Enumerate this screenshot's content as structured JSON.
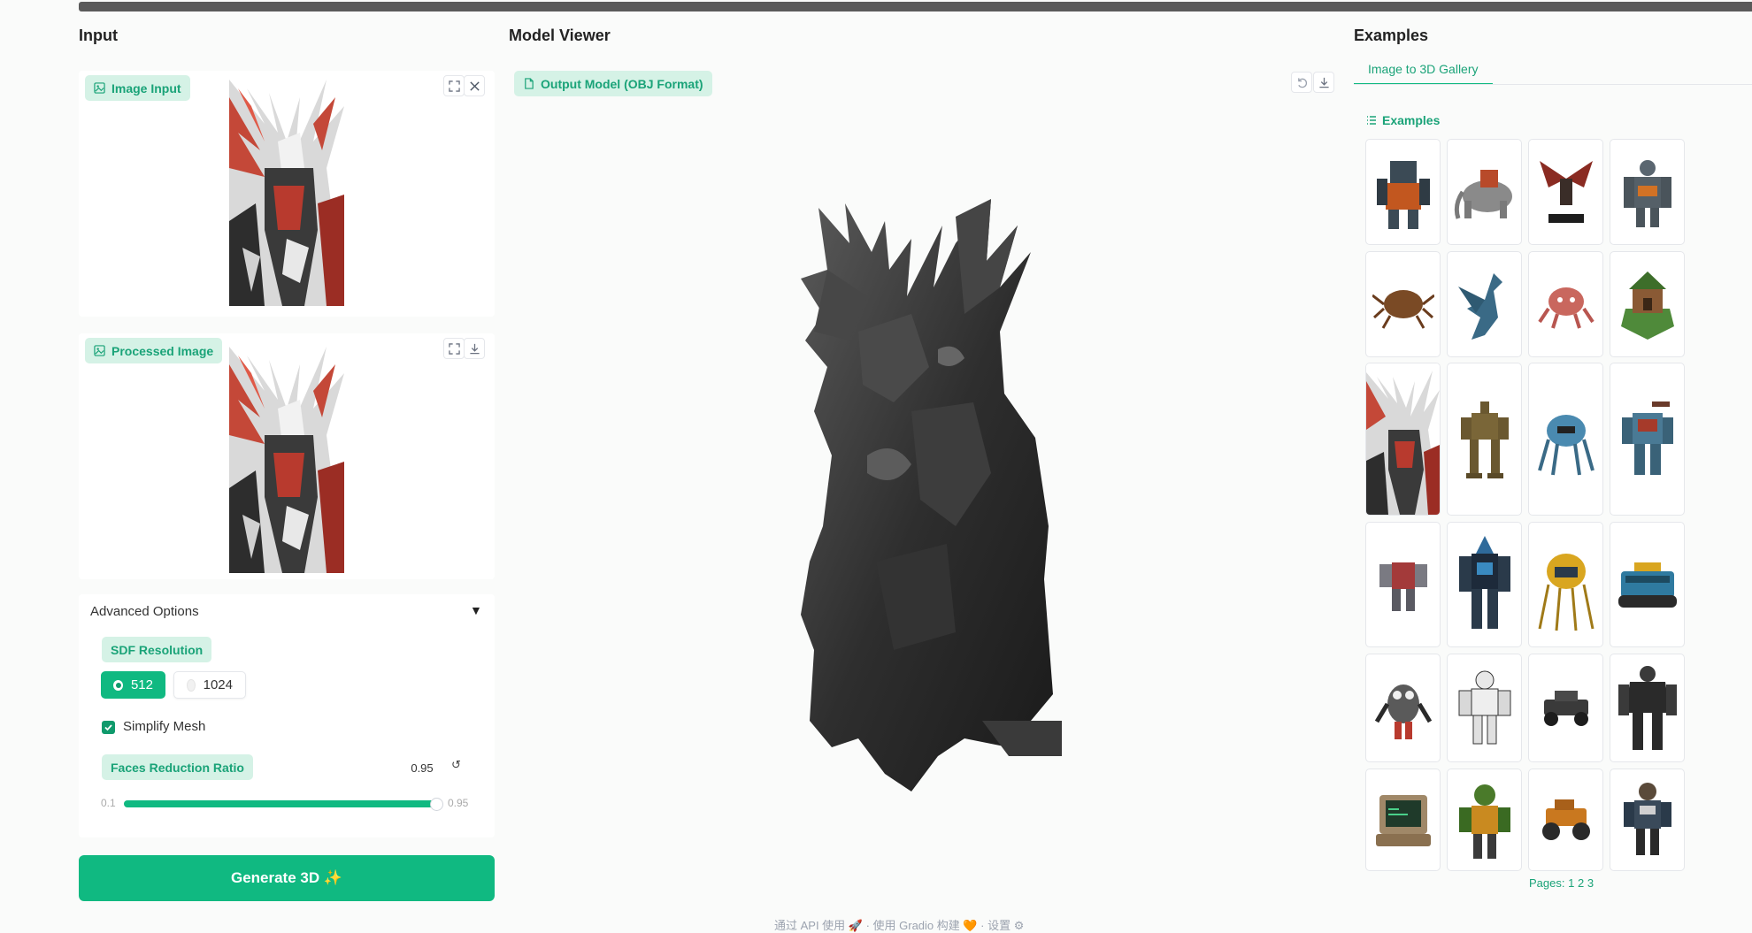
{
  "columns": {
    "input_title": "Input",
    "viewer_title": "Model Viewer",
    "examples_title": "Examples"
  },
  "input": {
    "image_input_label": "Image Input",
    "processed_image_label": "Processed Image"
  },
  "viewer": {
    "output_label": "Output Model (OBJ Format)"
  },
  "advanced": {
    "title": "Advanced Options",
    "arrow": "▼",
    "sdf_label": "SDF Resolution",
    "sdf_options": [
      "512",
      "1024"
    ],
    "sdf_selected": "512",
    "simplify_label": "Simplify Mesh",
    "simplify_checked": true,
    "faces_label": "Faces Reduction Ratio",
    "faces_value": "0.95",
    "reset_icon": "↺",
    "slider_min": "0.1",
    "slider_max": "0.95",
    "slider_fraction": 1.0
  },
  "generate_button": "Generate 3D ✨",
  "examples": {
    "tab_label": "Image to 3D Gallery",
    "section_label": "Examples",
    "pages_prefix": "Pages:",
    "pages": [
      "1",
      "2",
      "3"
    ]
  },
  "footer": "通过 API 使用  🚀  ·  使用 Gradio 构建 🧡  ·  设置 ⚙",
  "colors": {
    "accent": "#10b981",
    "accent_text": "#1aa378",
    "tag_bg": "#d5f2e6"
  }
}
